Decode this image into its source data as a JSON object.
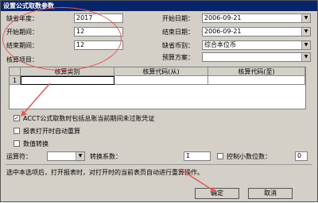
{
  "window": {
    "title": "设置公式取数参数"
  },
  "fields": {
    "default_year": {
      "label": "缺省年度：",
      "value": "2017"
    },
    "start_period": {
      "label": "开始期间：",
      "value": "12"
    },
    "end_period": {
      "label": "结束期间：",
      "value": "12"
    },
    "start_date": {
      "label": "开始日期：",
      "value": "2006-09-21"
    },
    "end_date": {
      "label": "结束日期：",
      "value": "2006-09-21"
    },
    "default_currency": {
      "label": "缺省币别：",
      "value": "综合本位币"
    },
    "budget_plan": {
      "label": "预算方案：",
      "value": ""
    }
  },
  "accounting_items": {
    "label": "核算项目：",
    "columns": [
      "核算类别",
      "核算代码(从)",
      "核算代码(至)"
    ],
    "rows": [
      [
        "1",
        "",
        "",
        ""
      ]
    ]
  },
  "options": {
    "acct_include_unposted": {
      "label": "ACCT公式取数时包括总账当前期间未过账凭证",
      "checked": true
    },
    "auto_recalc": {
      "label": "报表打开时自动重算",
      "checked": false
    },
    "numeric_convert": {
      "label": "数值转换",
      "checked": false
    }
  },
  "conversion": {
    "operator_label": "运算符：",
    "operator_value": "",
    "coefficient_label": "转换系数：",
    "coefficient_value": "1",
    "decimal_label": "控制小数位数：",
    "decimal_value": "0",
    "decimal_checked": false
  },
  "hint": "选中本选项后，打开报表时，对打开时的当前表页自动进行重算操作。",
  "buttons": {
    "ok": "确定",
    "cancel": "取消"
  },
  "colors": {
    "title_bar": "#0a246a",
    "annotation": "#e05a5a"
  }
}
